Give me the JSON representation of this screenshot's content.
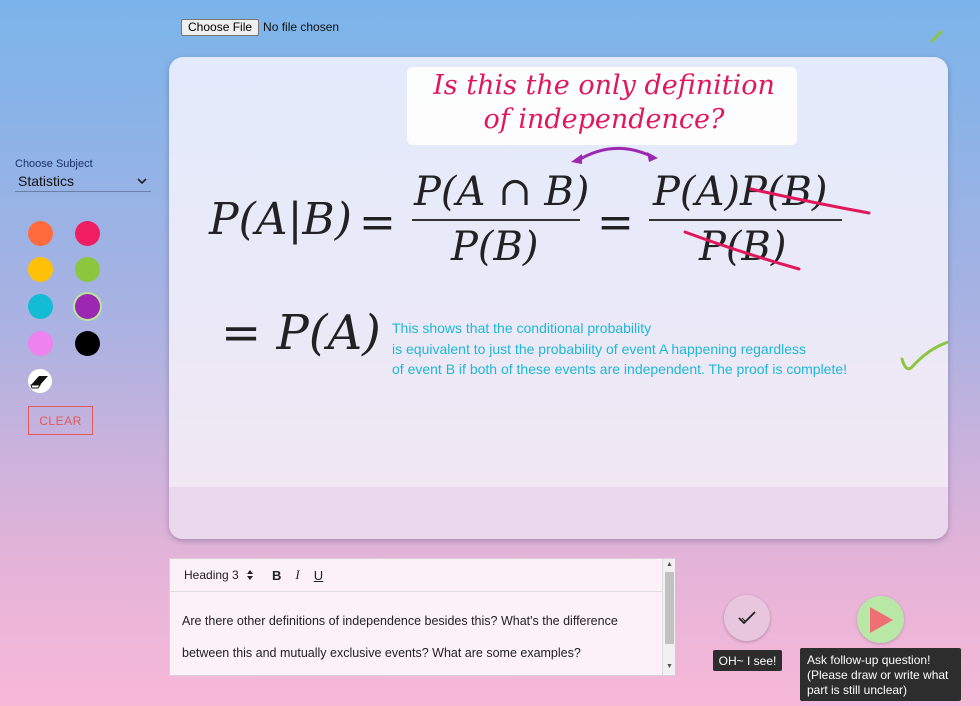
{
  "file_input": {
    "button_label": "Choose File",
    "status": "No file chosen"
  },
  "sidebar": {
    "subject_label": "Choose Subject",
    "subject_value": "Statistics",
    "colors": [
      "#ff6b3d",
      "#f01d63",
      "#ffc107",
      "#8cc63f",
      "#12bcd4",
      "#9c27b0",
      "#ee82ee",
      "#000000"
    ],
    "clear_label": "CLEAR"
  },
  "canvas": {
    "note_line1": "Is this the only definition",
    "note_line2": "of independence?",
    "formula": {
      "lhs_p": "P(",
      "lhs_a": "A",
      "lhs_bar": "|",
      "lhs_b": "B",
      "lhs_close": ")",
      "eq1": "=",
      "num1": "P(A ∩ B)",
      "den1": "P(B)",
      "eq2": "=",
      "num2_a": "P(A)",
      "num2_b": "P(B)",
      "den2": "P(B)",
      "result": "= P(A)"
    },
    "explanation": [
      "This shows that the conditional probability",
      "is equivalent to just the probability of event A happening regardless",
      "of event B if both of these events are independent.  The proof is complete!"
    ]
  },
  "editor": {
    "heading_select": "Heading 3",
    "bold": "B",
    "italic": "I",
    "underline": "U",
    "line1": "Are there other definitions of independence besides this?  What's the difference",
    "line2": "between this and mutually exclusive events?  What are some examples?"
  },
  "actions": {
    "ok_label": "OH~ I see!",
    "ask_label": "Ask follow-up question! (Please draw or write what part is still unclear)"
  }
}
